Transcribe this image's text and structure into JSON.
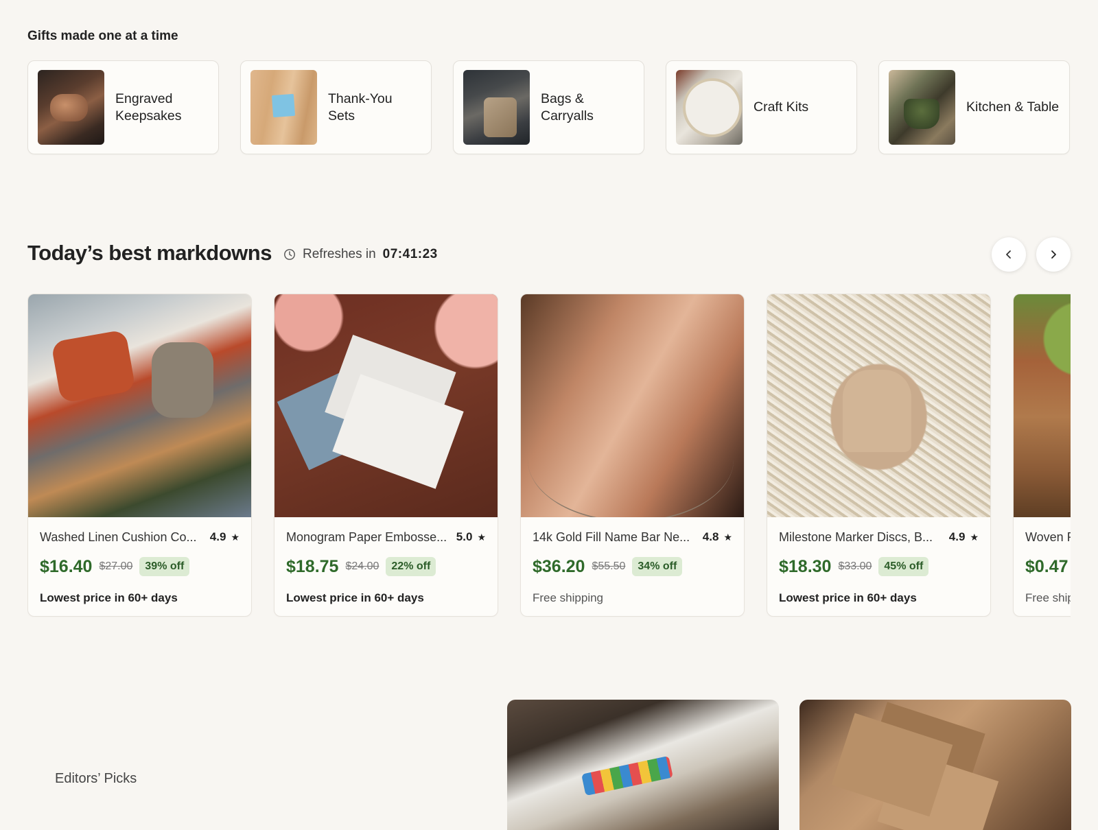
{
  "gifts": {
    "title": "Gifts made one at a time",
    "categories": [
      {
        "label": "Engraved\nKeepsakes"
      },
      {
        "label": "Thank-You Sets"
      },
      {
        "label": "Bags &\nCarryalls"
      },
      {
        "label": "Craft Kits"
      },
      {
        "label": "Kitchen & Table"
      }
    ]
  },
  "markdowns": {
    "title": "Today’s best markdowns",
    "refresh_label": "Refreshes in",
    "timer": "07:41:23",
    "products": [
      {
        "name": "Washed Linen Cushion Co...",
        "rating": "4.9",
        "price": "$16.40",
        "original": "$27.00",
        "discount": "39% off",
        "note": "Lowest price in 60+ days"
      },
      {
        "name": "Monogram Paper Embosse...",
        "rating": "5.0",
        "price": "$18.75",
        "original": "$24.00",
        "discount": "22% off",
        "note": "Lowest price in 60+ days"
      },
      {
        "name": "14k Gold Fill Name Bar Ne...",
        "rating": "4.8",
        "price": "$36.20",
        "original": "$55.50",
        "discount": "34% off",
        "note": "Free shipping"
      },
      {
        "name": "Milestone Marker Discs, B...",
        "rating": "4.9",
        "price": "$18.30",
        "original": "$33.00",
        "discount": "45% off",
        "note": "Lowest price in 60+ days"
      },
      {
        "name": "Woven Ra",
        "price": "$0.47",
        "note": "Free shipp"
      }
    ]
  },
  "editors": {
    "label": "Editors’ Picks"
  },
  "colors": {
    "background": "#f8f6f2",
    "price_green": "#2f6a2a",
    "discount_bg": "#dcebd3"
  },
  "icons": [
    "clock-icon",
    "chevron-left-icon",
    "chevron-right-icon",
    "star-icon"
  ]
}
